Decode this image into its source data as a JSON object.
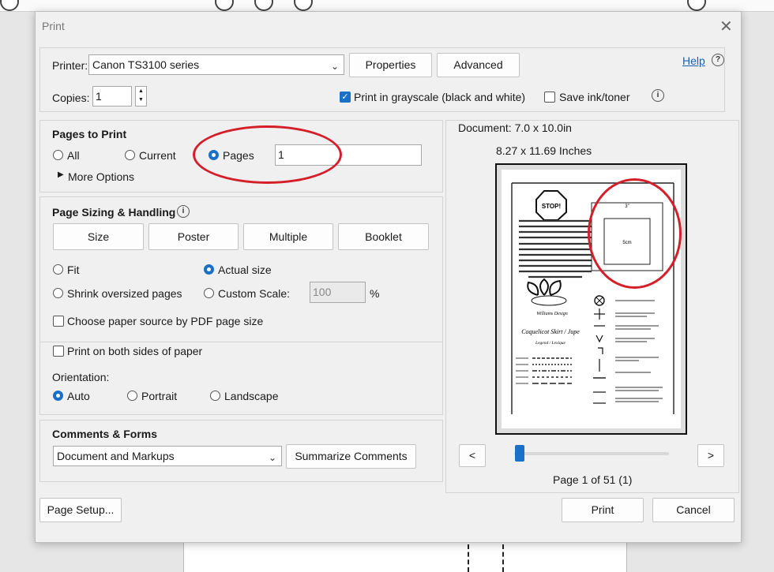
{
  "dialog": {
    "title": "Print"
  },
  "printer": {
    "label": "Printer:",
    "selected": "Canon TS3100 series",
    "properties_label": "Properties",
    "advanced_label": "Advanced",
    "help_label": "Help",
    "copies_label": "Copies:",
    "copies_value": "1",
    "grayscale_label": "Print in grayscale (black and white)",
    "grayscale_checked": true,
    "save_ink_label": "Save ink/toner",
    "save_ink_checked": false
  },
  "pages_to_print": {
    "title": "Pages to Print",
    "all_label": "All",
    "current_label": "Current",
    "pages_label": "Pages",
    "pages_value": "1",
    "selected": "Pages",
    "more_options_label": "More Options"
  },
  "sizing": {
    "title": "Page Sizing & Handling",
    "tabs": [
      "Size",
      "Poster",
      "Multiple",
      "Booklet"
    ],
    "fit_label": "Fit",
    "actual_size_label": "Actual size",
    "shrink_label": "Shrink oversized pages",
    "custom_scale_label": "Custom Scale:",
    "custom_scale_value": "100",
    "percent": "%",
    "paper_source_label": "Choose paper source by PDF page size",
    "selected": "Actual size"
  },
  "duplex": {
    "both_sides_label": "Print on both sides of paper",
    "orientation_label": "Orientation:",
    "auto_label": "Auto",
    "portrait_label": "Portrait",
    "landscape_label": "Landscape",
    "selected": "Auto"
  },
  "comments": {
    "title": "Comments & Forms",
    "selected": "Document and Markups",
    "summarize_label": "Summarize Comments"
  },
  "preview": {
    "document_size": "Document: 7.0 x 10.0in",
    "paper_size": "8.27 x 11.69 Inches",
    "prev_label": "<",
    "next_label": ">",
    "page_status": "Page 1 of 51 (1)",
    "slider_position": 0.0,
    "content": {
      "stop_sign": "STOP!",
      "measure_top": "3\"",
      "measure_box": "5cm",
      "brand": "Williams Design",
      "pattern_title": "Coquelicot Skirt / Jupe",
      "legend_label": "Legend / Lexique"
    }
  },
  "footer": {
    "page_setup_label": "Page Setup...",
    "print_label": "Print",
    "cancel_label": "Cancel"
  },
  "colors": {
    "accent": "#1a6fc9",
    "annotation_red": "#d41f2a"
  }
}
